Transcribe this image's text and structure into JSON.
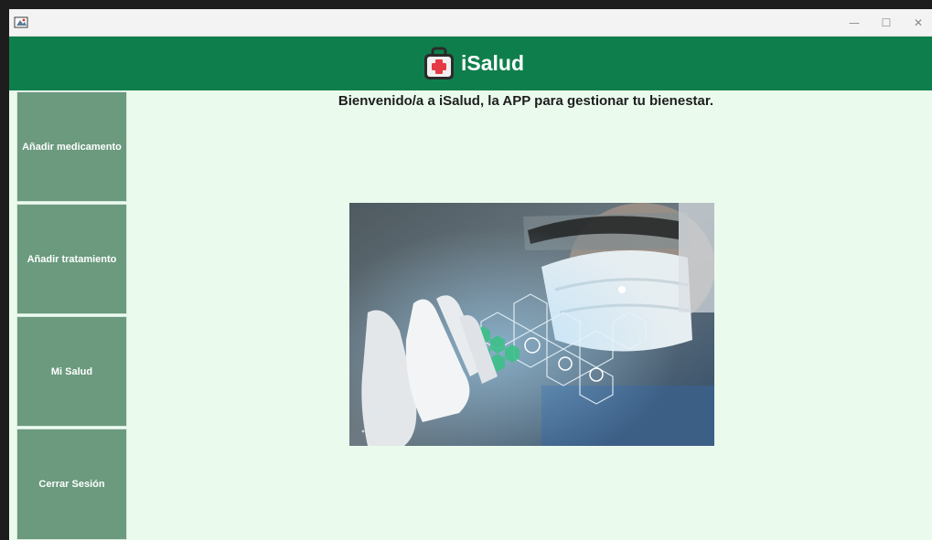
{
  "window": {
    "controls": {
      "minimize": "—",
      "maximize": "☐",
      "close": "✕"
    }
  },
  "header": {
    "app_name": "iSalud",
    "logo_icon": "medical-kit-icon",
    "background": "#0e7f4c"
  },
  "sidebar": {
    "items": [
      {
        "label": "Añadir medicamento"
      },
      {
        "label": "Añadir tratamiento"
      },
      {
        "label": "Mi Salud"
      },
      {
        "label": "Cerrar Sesión"
      }
    ],
    "button_color": "#6b9a7e"
  },
  "main": {
    "welcome_text": "Bienvenido/a a iSalud, la APP para gestionar tu bienestar.",
    "hero_image": "gloved-hand-with-hexagon-health-icons",
    "background": "#eafbee"
  }
}
